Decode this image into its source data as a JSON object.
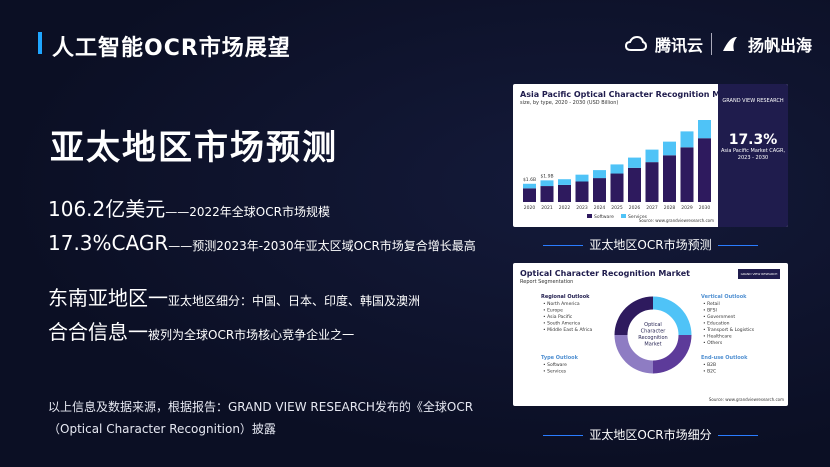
{
  "header": {
    "title": "人工智能OCR市场展望",
    "brand1": "腾讯云",
    "brand2": "扬帆出海"
  },
  "main": {
    "heading": "亚太地区市场预测",
    "stats": [
      {
        "big": "106.2亿美元",
        "small": "——2022年全球OCR市场规模"
      },
      {
        "big": "17.3%CAGR",
        "small": "——预测2023年-2030年亚太区域OCR市场复合增长最高"
      },
      {
        "big": "东南亚地区一",
        "small": "亚太地区细分：中国、日本、印度、韩国及澳洲"
      },
      {
        "big": "合合信息一",
        "small": "被列为全球OCR市场核心竞争企业之一"
      }
    ],
    "note": "以上信息及数据来源，根据报告：GRAND VIEW RESEARCH发布的《全球OCR（Optical Character Recognition）披露"
  },
  "chart_card": {
    "title": "Asia Pacific Optical Character Recognition Market",
    "subtitle": "size, by type, 2020 - 2030 (USD Billion)",
    "panel_brand": "GRAND VIEW RESEARCH",
    "cagr": "17.3%",
    "cagr_label": "Asia Pacific Market CAGR, 2023 - 2030",
    "source": "Source: www.grandviewresearch.com",
    "caption": "亚太地区OCR市场预测"
  },
  "chart_data": {
    "type": "bar",
    "title": "Asia Pacific Optical Character Recognition Market",
    "categories": [
      "2020",
      "2021",
      "2022",
      "2023",
      "2024",
      "2025",
      "2026",
      "2027",
      "2028",
      "2029",
      "2030"
    ],
    "series": [
      {
        "name": "Software",
        "values": [
          1.2,
          1.4,
          1.5,
          1.8,
          2.1,
          2.5,
          3.0,
          3.5,
          4.1,
          4.8,
          5.6
        ]
      },
      {
        "name": "Services",
        "values": [
          0.4,
          0.5,
          0.5,
          0.6,
          0.7,
          0.8,
          0.9,
          1.1,
          1.2,
          1.4,
          1.6
        ]
      }
    ],
    "data_labels": [
      "$1.6B",
      "$1.9B"
    ],
    "colors": {
      "Software": "#2e1a5e",
      "Services": "#4fc3f7"
    }
  },
  "seg_card": {
    "title": "Optical Character Recognition Market",
    "subtitle": "Report Segmentation",
    "panel_brand": "GRAND VIEW RESEARCH",
    "regional": {
      "label": "Regional Outlook",
      "items": [
        "North America",
        "Europe",
        "Asia Pacific",
        "South America",
        "Middle East & Africa"
      ]
    },
    "type": {
      "label": "Type Outlook",
      "items": [
        "Software",
        "Services"
      ]
    },
    "vertical": {
      "label": "Vertical Outlook",
      "items": [
        "Retail",
        "BFSI",
        "Government",
        "Education",
        "Transport & Logistics",
        "Healthcare",
        "Others"
      ]
    },
    "enduse": {
      "label": "End-use Outlook",
      "items": [
        "B2B",
        "B2C"
      ]
    },
    "donut_label": "Optical Character Recognition Market",
    "source": "Source: www.grandviewresearch.com",
    "caption": "亚太地区OCR市场细分"
  }
}
